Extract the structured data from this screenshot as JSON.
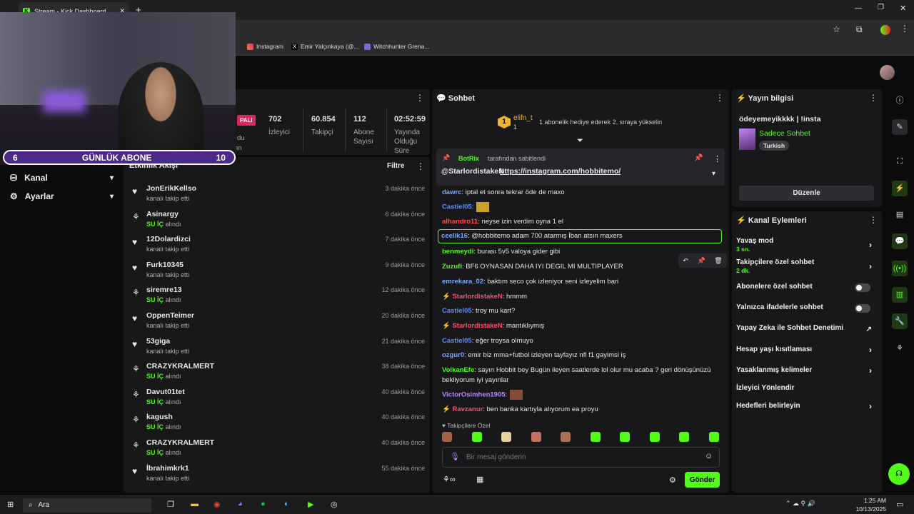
{
  "browser": {
    "tab_title": "Stream - Kick Dashboard",
    "bookmarks": [
      "Instagram",
      "Emir Yalçınkaya (@...",
      "Witchhunter Grena..."
    ]
  },
  "webcam": {
    "sub_goal_current": "6",
    "sub_goal_label": "GÜNLÜK ABONE",
    "sub_goal_target": "10"
  },
  "stats": {
    "live_badge": "PALI",
    "partial_labels": [
      "du",
      "yayın",
      "Gelir"
    ],
    "viewers": {
      "value": "702",
      "label": "İzleyici"
    },
    "followers": {
      "value": "60.854",
      "label": "Takipçi"
    },
    "subs": {
      "value": "112",
      "label": "Abone Sayısı"
    },
    "uptime": {
      "value": "02:52:59",
      "label": "Yayında Olduğu Süre"
    }
  },
  "nav": {
    "channel": "Kanal",
    "settings": "Ayarlar"
  },
  "activity": {
    "title": "Etkinlik Akışı",
    "filter": "Filtre",
    "items": [
      {
        "icon": "heart",
        "name": "JonErikKellso",
        "sub": "kanalı takip etti",
        "time": "3 dakika önce"
      },
      {
        "icon": "gift",
        "name": "Asinargy",
        "sub_b": "SU İÇ",
        "sub": " alındı",
        "time": "6 dakika önce"
      },
      {
        "icon": "heart",
        "name": "12Dolardizci",
        "sub": "kanalı takip etti",
        "time": "7 dakika önce"
      },
      {
        "icon": "heart",
        "name": "Furk10345",
        "sub": "kanalı takip etti",
        "time": "9 dakika önce"
      },
      {
        "icon": "gift",
        "name": "siremre13",
        "sub_b": "SU İÇ",
        "sub": " alındı",
        "time": "12 dakika önce"
      },
      {
        "icon": "heart",
        "name": "OppenTeimer",
        "sub": "kanalı takip etti",
        "time": "20 dakika önce"
      },
      {
        "icon": "heart",
        "name": "53giga",
        "sub": "kanalı takip etti",
        "time": "21 dakika önce"
      },
      {
        "icon": "gift",
        "name": "CRAZYKRALMERT",
        "sub_b": "SU İÇ",
        "sub": " alındı",
        "time": "38 dakika önce"
      },
      {
        "icon": "gift",
        "name": "Davut01tet",
        "sub_b": "SU İÇ",
        "sub": " alındı",
        "time": "40 dakika önce"
      },
      {
        "icon": "gift",
        "name": "kagush",
        "sub_b": "SU İÇ",
        "sub": " alındı",
        "time": "40 dakika önce"
      },
      {
        "icon": "gift",
        "name": "CRAZYKRALMERT",
        "sub_b": "SU İÇ",
        "sub": " alındı",
        "time": "40 dakika önce"
      },
      {
        "icon": "heart",
        "name": "İbrahimkrk1",
        "sub": "kanalı takip etti",
        "time": "55 dakika önce"
      }
    ]
  },
  "chat": {
    "title": "Sohbet",
    "top_user": "elifn_t",
    "top_count": "1",
    "top_rank": "1",
    "top_text": "1 abonelik hediye ederek 2. sıraya yükselin",
    "pinned_by": "BotRix",
    "pinned_by_suffix": "tarafından sabitlendi",
    "pinned_text": "@StarlordistakeN",
    "pinned_link": "https://instagram.com/hobbitemo/",
    "messages": [
      {
        "user": "dawrc",
        "color": "#7aa7ff",
        "text": ": iptal et sonra tekrar öde de maxo"
      },
      {
        "user": "Castiel05",
        "color": "#5b8cff",
        "text": ":"
      },
      {
        "user": "alhandro11",
        "color": "#ff4d4d",
        "text": ": neyse izin verdim oyna 1 el"
      },
      {
        "user": "ceelik16",
        "color": "#7aa7ff",
        "text": ": @hobbitemo adam 700 atarmış İban atsın maxers"
      },
      {
        "user": "benmeydi",
        "color": "#53fc18",
        "text": ": burası 5v5 valoya gider gibi"
      },
      {
        "user": "Zuzufi",
        "color": "#53fc18",
        "text": ": BF6 OYNASAN DAHA IYI DEGIL MI MULTIPLAYER"
      },
      {
        "user": "emrekara_02",
        "color": "#7aa7ff",
        "text": ": baktım seco çok izleniyor seni izleyelim bari"
      },
      {
        "user": "StarlordistakeN",
        "color": "#ff4d6d",
        "text": ": hmmm"
      },
      {
        "user": "Castiel05",
        "color": "#5b8cff",
        "text": ": troy mu kart?"
      },
      {
        "user": "StarlordistakeN",
        "color": "#ff4d6d",
        "text": ": mantıklıymış"
      },
      {
        "user": "Castiel05",
        "color": "#5b8cff",
        "text": ": eğer troysa olmuyo"
      },
      {
        "user": "ozgur0",
        "color": "#7aa7ff",
        "text": ": emir biz mma+futbol izleyen tayfayız nfl f1 gayimsi iş"
      },
      {
        "user": "VolkanEfe",
        "color": "#53fc18",
        "text": ": sayın Hobbit bey Bugün ileyen saatlerde lol olur mu acaba ? geri dönüşünüzü bekliyorum iyi yayınlar"
      },
      {
        "user": "VictorOsimhen1905",
        "color": "#c084fc",
        "text": ":"
      },
      {
        "user": "Ravzanur",
        "color": "#ff4d6d",
        "text": ": ben banka kartıyla alıyorum ea proyu"
      }
    ],
    "emote_label": "Takipçilere Özel",
    "input_placeholder": "Bir mesaj gönderin",
    "send_label": "Gönder"
  },
  "stream_info": {
    "title": "Yayın bilgisi",
    "stream_title": "ödeyemeyikkkk | !insta",
    "category": "Sadece Sohbet",
    "language": "Turkish",
    "edit": "Düzenle"
  },
  "channel_actions": {
    "title": "Kanal Eylemleri",
    "items": [
      {
        "label": "Yavaş mod",
        "sub": "3 sn.",
        "kind": "chev"
      },
      {
        "label": "Takipçilere özel sohbet",
        "sub": "2 dk.",
        "kind": "chev"
      },
      {
        "label": "Abonelere özel sohbet",
        "kind": "toggle"
      },
      {
        "label": "Yalnızca ifadelerle sohbet",
        "kind": "toggle"
      },
      {
        "label": "Yapay Zeka ile Sohbet Denetimi",
        "kind": "ext"
      },
      {
        "label": "Hesap yaşı kısıtlaması",
        "kind": "chev"
      },
      {
        "label": "Yasaklanmış kelimeler",
        "kind": "chev"
      },
      {
        "label": "İzleyici Yönlendir",
        "kind": "none"
      },
      {
        "label": "Hedefleri belirleyin",
        "kind": "chev"
      }
    ]
  },
  "taskbar": {
    "search": "Ara",
    "time": "1:25 AM",
    "date": "10/13/2025"
  },
  "colors": {
    "accent": "#53fc18",
    "panel": "#18181b",
    "bg": "#0b0b0c"
  }
}
